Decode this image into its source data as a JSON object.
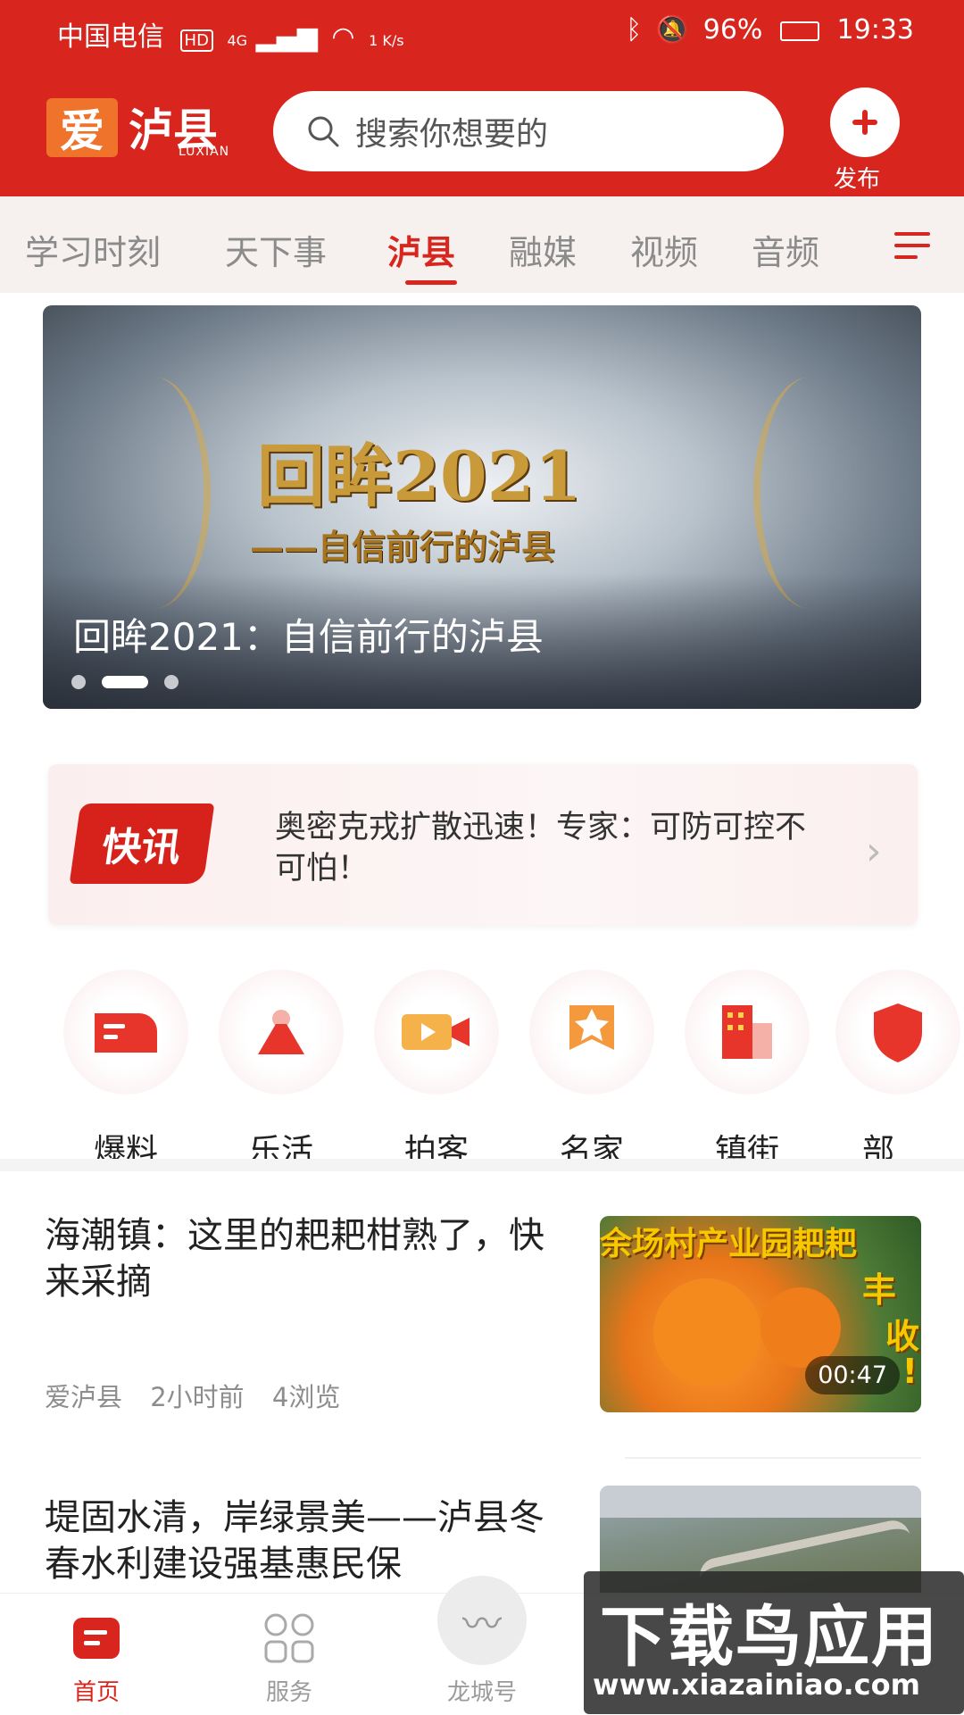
{
  "status": {
    "carrier": "中国电信",
    "network": "4G",
    "speed": "1 K/s",
    "battery": "96%",
    "time": "19:33"
  },
  "header": {
    "logo_mark": "爱",
    "logo_text": "泸县",
    "logo_sub": "LUXIAN",
    "search_placeholder": "搜索你想要的",
    "publish_label": "发布"
  },
  "tabs": [
    "学习时刻",
    "天下事",
    "泸县",
    "融媒",
    "视频",
    "音频"
  ],
  "active_tab": "泸县",
  "banner": {
    "art_line1": "回眸2021",
    "art_line2": "——自信前行的泸县",
    "caption": "回眸2021：自信前行的泸县",
    "slide_count": 3,
    "active_slide": 2
  },
  "flash": {
    "badge": "快讯",
    "text": "奥密克戎扩散迅速！专家：可防可控不可怕！"
  },
  "quick_icons": [
    {
      "label": "爆料",
      "icon": "megaphone-icon"
    },
    {
      "label": "乐活",
      "icon": "person-icon"
    },
    {
      "label": "拍客",
      "icon": "video-camera-icon"
    },
    {
      "label": "名家",
      "icon": "star-badge-icon"
    },
    {
      "label": "镇街",
      "icon": "buildings-icon"
    },
    {
      "label": "部",
      "icon": "shield-icon"
    }
  ],
  "news": [
    {
      "title": "海潮镇：这里的耙耙柑熟了，快来采摘",
      "source": "爱泸县",
      "time": "2小时前",
      "views": "4浏览",
      "thumb_text": "余场村产业园耙耙",
      "thumb_text2": "丰",
      "thumb_text3": "收",
      "thumb_text4": "!",
      "duration": "00:47"
    },
    {
      "title": "堤固水清，岸绿景美——泸县冬春水利建设强基惠民保"
    }
  ],
  "bottom_nav": [
    {
      "label": "首页",
      "icon": "home-icon",
      "active": true
    },
    {
      "label": "服务",
      "icon": "grid-icon",
      "active": false
    },
    {
      "label": "龙城号",
      "icon": "dragon-icon",
      "active": false
    }
  ],
  "watermark": {
    "line1": "下载鸟应用",
    "line2": "www.xiazainiao.com"
  },
  "colors": {
    "brand": "#d8261e",
    "accent": "#f0732b"
  }
}
